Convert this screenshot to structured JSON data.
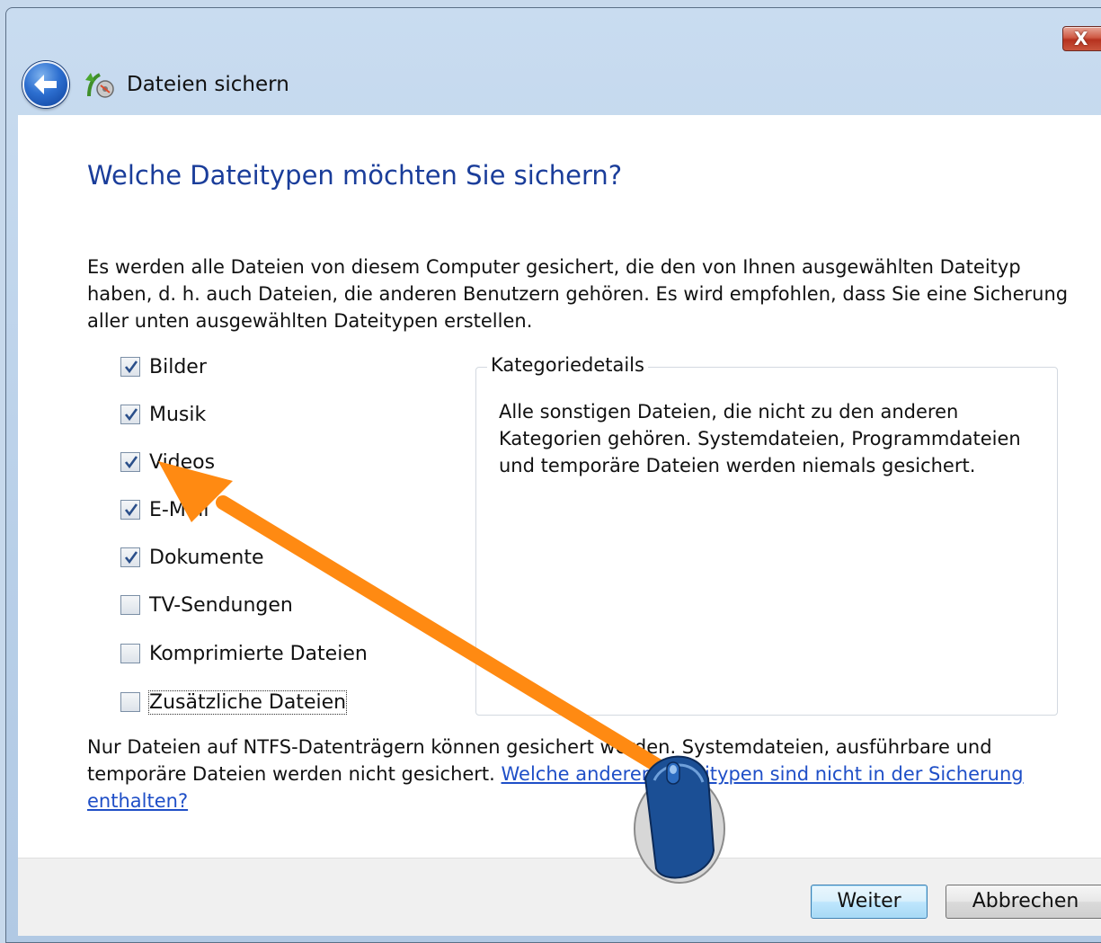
{
  "window": {
    "title": "Dateien sichern",
    "close_label": "X"
  },
  "page": {
    "heading": "Welche Dateitypen möchten Sie sichern?",
    "intro": "Es werden alle Dateien von diesem Computer gesichert, die den von Ihnen ausgewählten Dateityp haben, d. h. auch Dateien, die anderen Benutzern gehören. Es wird empfohlen, dass Sie eine Sicherung aller unten ausgewählten Dateitypen erstellen."
  },
  "filetypes": [
    {
      "label": "Bilder",
      "checked": true
    },
    {
      "label": "Musik",
      "checked": true
    },
    {
      "label": "Videos",
      "checked": true
    },
    {
      "label": "E-Mail",
      "checked": true
    },
    {
      "label": "Dokumente",
      "checked": true
    },
    {
      "label": "TV-Sendungen",
      "checked": false
    },
    {
      "label": "Komprimierte Dateien",
      "checked": false
    },
    {
      "label": "Zusätzliche Dateien",
      "checked": false
    }
  ],
  "category_details": {
    "legend": "Kategoriedetails",
    "text": "Alle sonstigen Dateien, die nicht zu den anderen Kategorien gehören. Systemdateien, Programmdateien und temporäre Dateien werden niemals gesichert."
  },
  "footer": {
    "note": "Nur Dateien auf NTFS-Datenträgern können gesichert werden. Systemdateien, ausführbare und temporäre Dateien werden nicht gesichert. ",
    "link": "Welche anderen Dateitypen sind nicht in der Sicherung enthalten?"
  },
  "buttons": {
    "next": "Weiter",
    "cancel": "Abbrechen"
  },
  "icons": {
    "back": "back-arrow-icon",
    "app": "backup-files-icon",
    "annotation_arrow": "orange-arrow",
    "annotation_mouse": "mouse-icon"
  },
  "colors": {
    "heading": "#1a3d9a",
    "link": "#1f4fc7",
    "annotation_arrow": "#ff8a12",
    "mouse_body": "#1b4f95"
  }
}
